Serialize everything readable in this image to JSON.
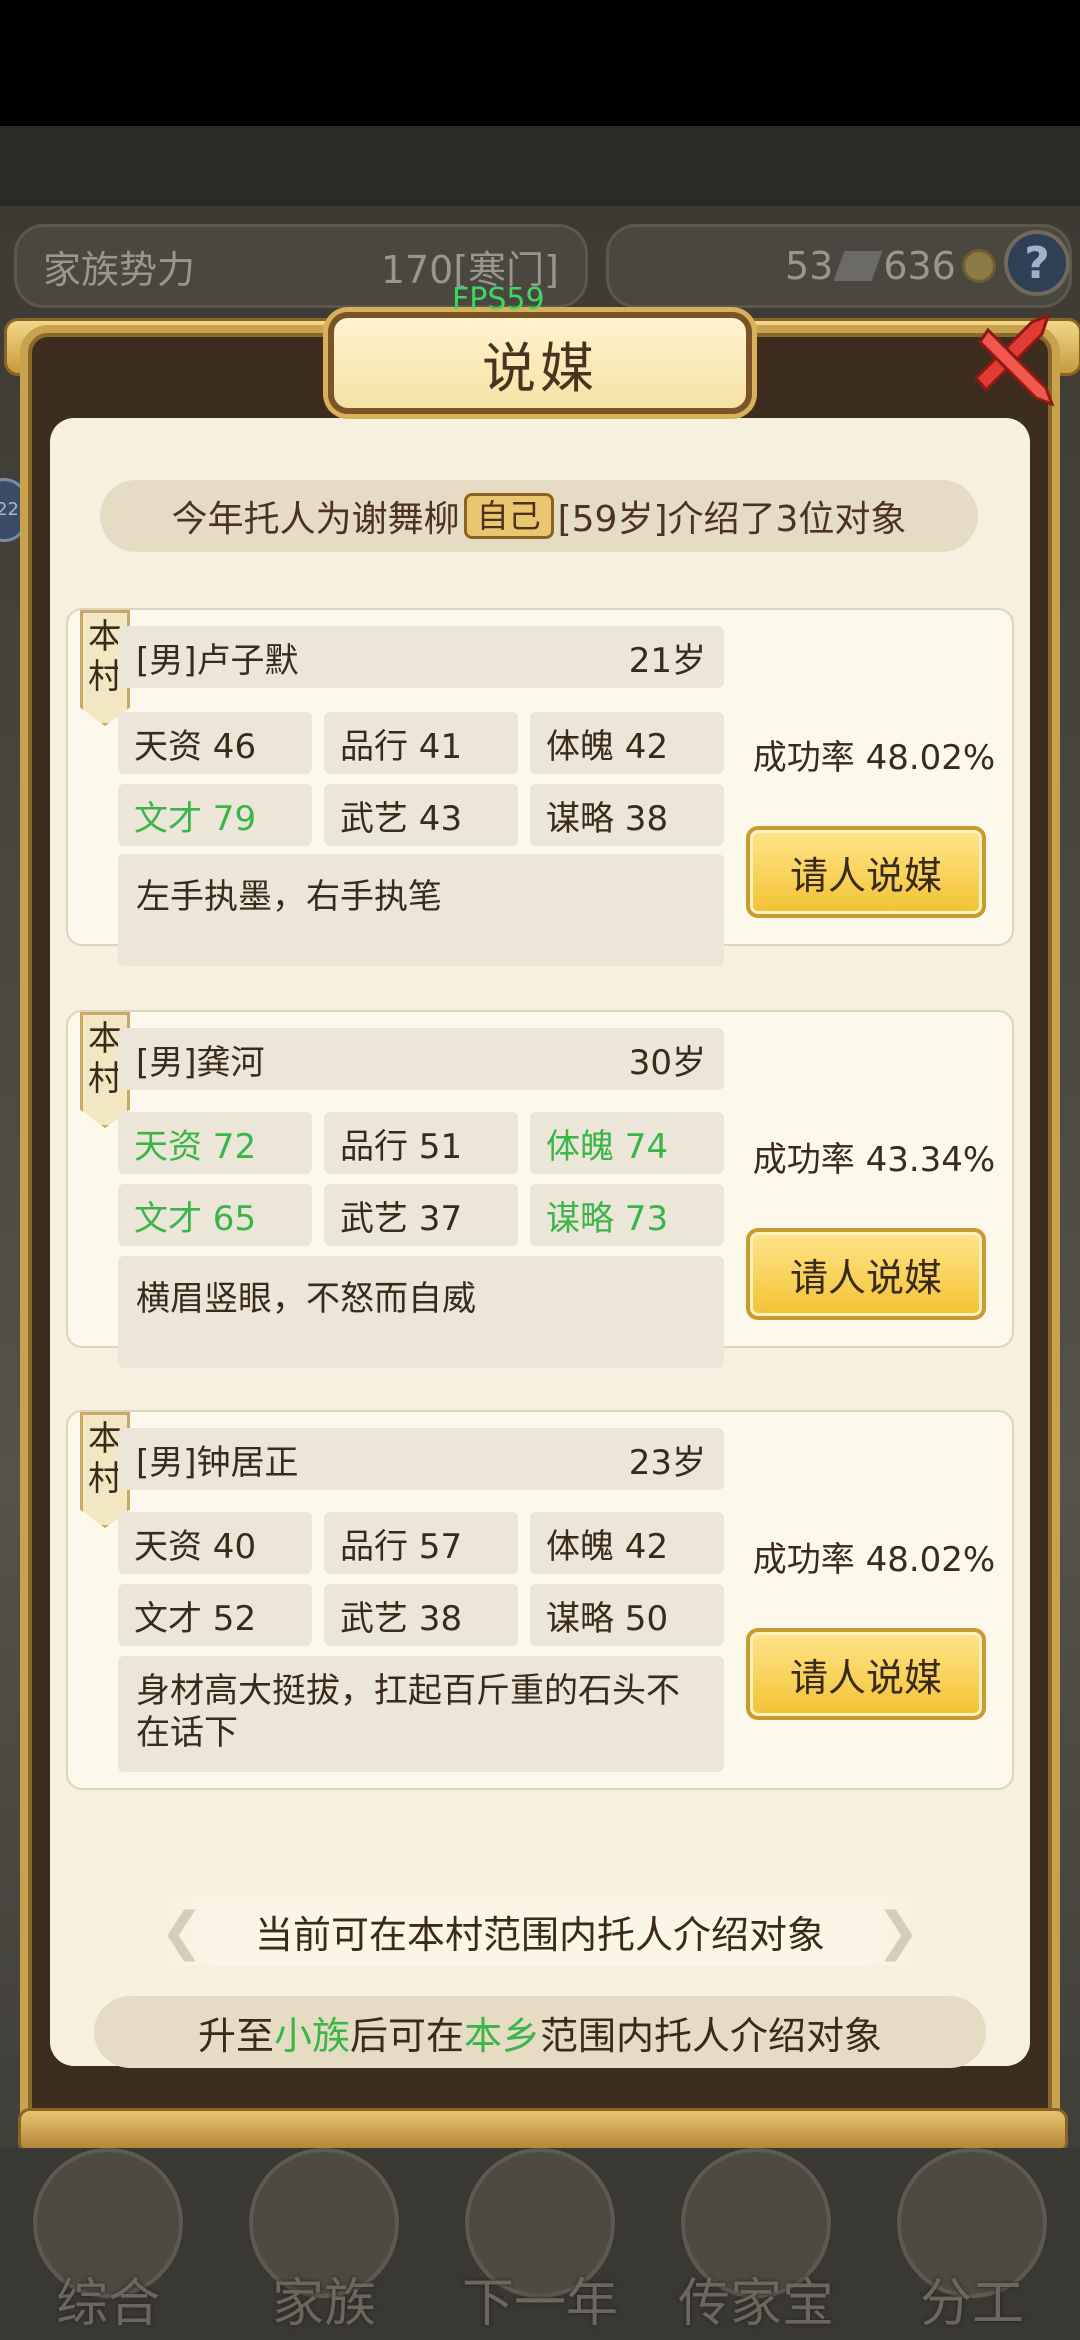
{
  "hud": {
    "clan_power_label": "家族势力",
    "clan_power_value": "170[寒门]",
    "resource_1": "53",
    "resource_2": "636",
    "help_label": "?",
    "fps": "FPS59",
    "side_badge": "22"
  },
  "dialog": {
    "title": "说媒",
    "info_prefix": "今年托人为谢舞柳",
    "info_tag": "自己",
    "info_suffix": "[59岁]介绍了3位对象",
    "footer_range": "当前可在本村范围内托人介绍对象",
    "footer_upgrade": {
      "p1": "升至",
      "g1": "小族",
      "p2": "后可在",
      "g2": "本乡",
      "p3": "范围内托人介绍对象"
    }
  },
  "candidates": [
    {
      "ribbon": "本村",
      "name": "[男]卢子默",
      "age": "21岁",
      "stats": [
        {
          "text": "天资 46",
          "highlight": false
        },
        {
          "text": "品行 41",
          "highlight": false
        },
        {
          "text": "体魄 42",
          "highlight": false
        },
        {
          "text": "文才 79",
          "highlight": true
        },
        {
          "text": "武艺 43",
          "highlight": false
        },
        {
          "text": "谋略 38",
          "highlight": false
        }
      ],
      "desc": "左手执墨，右手执笔",
      "rate": "成功率 48.02%",
      "button": "请人说媒"
    },
    {
      "ribbon": "本村",
      "name": "[男]龚河",
      "age": "30岁",
      "stats": [
        {
          "text": "天资 72",
          "highlight": true
        },
        {
          "text": "品行 51",
          "highlight": false
        },
        {
          "text": "体魄 74",
          "highlight": true
        },
        {
          "text": "文才 65",
          "highlight": true
        },
        {
          "text": "武艺 37",
          "highlight": false
        },
        {
          "text": "谋略 73",
          "highlight": true
        }
      ],
      "desc": "横眉竖眼，不怒而自威",
      "rate": "成功率 43.34%",
      "button": "请人说媒"
    },
    {
      "ribbon": "本村",
      "name": "[男]钟居正",
      "age": "23岁",
      "stats": [
        {
          "text": "天资 40",
          "highlight": false
        },
        {
          "text": "品行 57",
          "highlight": false
        },
        {
          "text": "体魄 42",
          "highlight": false
        },
        {
          "text": "文才 52",
          "highlight": false
        },
        {
          "text": "武艺 38",
          "highlight": false
        },
        {
          "text": "谋略 50",
          "highlight": false
        }
      ],
      "desc": "身材高大挺拔，扛起百斤重的石头不在话下",
      "rate": "成功率 48.02%",
      "button": "请人说媒"
    }
  ],
  "bottom_nav": [
    "综合",
    "家族",
    "下一年",
    "传家宝",
    "分工"
  ],
  "colors": {
    "highlight_green": "#3bb54a",
    "button_gold": "#f2c233",
    "frame_gold": "#c9a24f"
  }
}
